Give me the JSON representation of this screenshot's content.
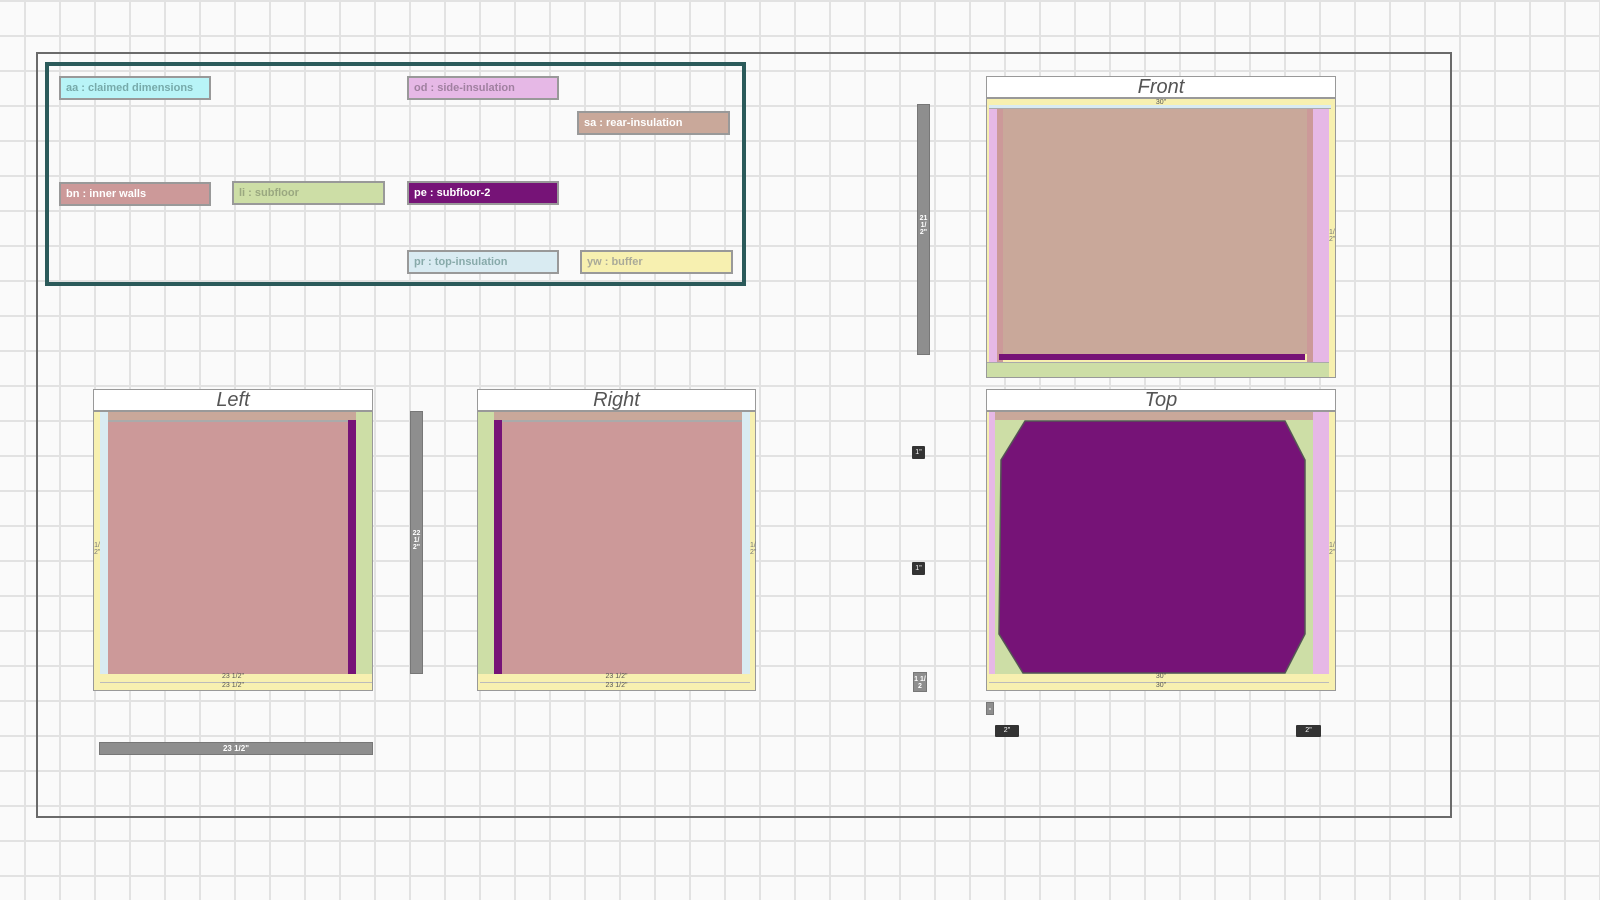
{
  "colors": {
    "claimed": "#b8f4f7",
    "side_insulation": "#e6b8e6",
    "rear_insulation": "#c9a89a",
    "inner_walls": "#cc9999",
    "subfloor": "#cddea6",
    "subfloor2": "#761377",
    "top_insulation": "#d9ebf2",
    "buffer": "#f7f0b0"
  },
  "legend": {
    "aa": "aa : claimed dimensions",
    "od": "od : side-insulation",
    "sa": "sa : rear-insulation",
    "bn": "bn : inner walls",
    "li": "li : subfloor",
    "pe": "pe : subfloor-2",
    "pr": "pr : top-insulation",
    "yw": "yw : buffer"
  },
  "views": {
    "left": "Left",
    "right": "Right",
    "front": "Front",
    "top": "Top"
  },
  "dimensions": {
    "left_bottom_inner": "23 1/2\"",
    "left_bottom_outer": "23 1/2\"",
    "right_bottom_inner": "23 1/2\"",
    "right_bottom_outer": "23 1/2\"",
    "top_bottom_inner": "30\"",
    "top_bottom_outer": "30\"",
    "front_top": "30\"",
    "left_side": "1/2\"",
    "right_side": "1/2\"",
    "front_side": "1/2\"",
    "top_side": "1/2\"",
    "height_bar": "22 1/2\"",
    "front_height_bar": "21 1/2\"",
    "width_bar": "23 1/2\"",
    "tag_1": "1\"",
    "tag_2": "1\"",
    "tag_3": "1 1/2",
    "tag_4": "-",
    "tag_5": "2\"",
    "tag_6": "2\""
  }
}
